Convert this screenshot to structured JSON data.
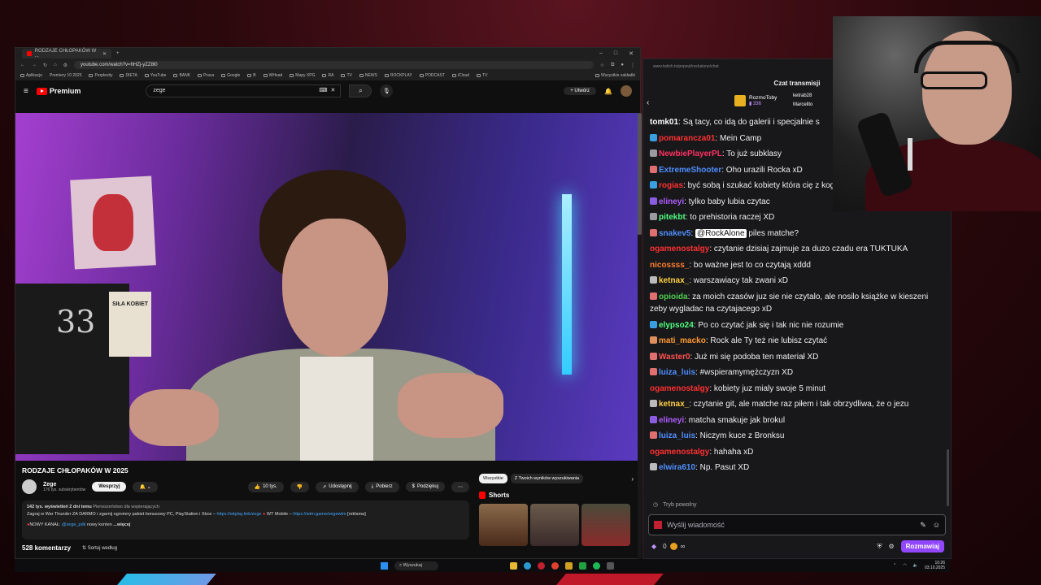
{
  "browser": {
    "tab_title": "RODZAJE CHŁOPAKÓW W ...",
    "url": "youtube.com/watch?v=hHZj-yZZ8l0",
    "bookmarks": [
      "Aplikacje",
      "Premiery 10 2025",
      "Perplexity",
      "DIETA",
      "YouTube",
      "BANK",
      "Praca",
      "Google",
      "B",
      "WHead",
      "Mapy XPG",
      "RA",
      "TV",
      "NEWS",
      "ROCKPLAY",
      "PODCAST",
      "iCloud",
      "TV",
      "Wszystkie zakładki"
    ]
  },
  "youtube": {
    "logo": "Premium",
    "search_value": "zege",
    "create_label": "Utwórz",
    "video_book_text": "SIŁA KOBIET",
    "video_board_text": "33",
    "title": "RODZAJE CHŁOPAKÓW W 2025",
    "channel": "Zege",
    "subs": "176 tys. subskrybentów",
    "support_label": "Wesprzyj",
    "likes": "10 tys.",
    "share_label": "Udostępnij",
    "download_label": "Pobierz",
    "thanks_label": "Podziękuj",
    "desc_stats": "142 tys. wyświetleń  2 dni temu",
    "desc_premiere": "Pierwszeństwo dla wspierających",
    "desc_line2_a": "Zagraj w War Thunder ZA DARMO i zgarnij ogromny pakiet bonusowy PC, PlayStation i Xbox –",
    "desc_link1": "https://wtplay.link/zege",
    "desc_line2_b": "WT Mobile –",
    "desc_link2": "https://wtm.game/zegewtm",
    "desc_line2_c": "[reklama]",
    "desc_line3_a": "NOWY KANAŁ:",
    "desc_link3": "@zege_pdk",
    "desc_line3_b": "nowy konten",
    "desc_more": "...więcej",
    "comments_count": "528 komentarzy",
    "sort_label": "Sortuj według",
    "chip_all": "Wszystkie",
    "chip_search": "Z Twoich wyników wyszukiwania",
    "shorts_label": "Shorts"
  },
  "chat": {
    "url": "www.twitch.tv/popout/rockalone/chat",
    "title": "Czat transmisji",
    "gift_user": "RozmoToby",
    "gift_count": "336",
    "gift_user2": "ketrab28",
    "gift_user3": "Marcelito",
    "messages": [
      {
        "user": "tomk01",
        "color": "#ffffff",
        "text": ": Są tacy, co idą do galerii i specjalnie s",
        "badge": ""
      },
      {
        "user": "pomarancza01",
        "color": "#ff3030",
        "text": ": Mein Camp",
        "badge": "#3a9fe0"
      },
      {
        "user": "NewbiePlayerPL",
        "color": "#ff3060",
        "text": ": To już subklasy",
        "badge": "#9a9aa0"
      },
      {
        "user": "ExtremeShooter",
        "color": "#4f8fff",
        "text": ": Oho urazili Rocka xD",
        "badge": "#e07070"
      },
      {
        "user": "rogias",
        "color": "#ff3030",
        "text": ": być sobą i szukać kobiety która cię z kogoś kim się nie jest",
        "badge": "#3a9fe0",
        "wrap": true
      },
      {
        "user": "elineyi",
        "color": "#b05cff",
        "text": ": tylko baby lubia czytac",
        "badge": "#8a5ce0"
      },
      {
        "user": "pitekbt",
        "color": "#4fff7f",
        "text": ": to prehistoria raczej XD",
        "badge": "#9a9aa0"
      },
      {
        "user": "snakev5",
        "color": "#4f8fff",
        "text": ": ",
        "mention": "@RockAlone",
        "after": " piles matche?",
        "badge": "#e07070"
      },
      {
        "user": "ogamenostalgy",
        "color": "#ff3030",
        "text": ": czytanie dzisiaj zajmuje za duzo czadu era TUKTUKA",
        "badge": ""
      },
      {
        "user": "nicossss_",
        "color": "#ff7f2a",
        "text": ": bo ważne jest to co czytają xddd",
        "badge": ""
      },
      {
        "user": "ketnax_",
        "color": "#ffd040",
        "text": ": warszawiacy tak zwani xD",
        "badge": "#bbb"
      },
      {
        "user": "opioida",
        "color": "#4fcf4f",
        "text": ": za moich czasów juz sie nie czytalo, ale nosilo książke w kieszeni zeby wygladac na czytajacego xD",
        "badge": "#e07070",
        "wrap": true
      },
      {
        "user": "elypso24",
        "color": "#4fff7f",
        "text": ": Po co czytać jak się i tak nic nie rozumie",
        "badge": "#3a9fe0"
      },
      {
        "user": "mati_macko",
        "color": "#ff9a30",
        "text": ": Rock ale Ty też nie lubisz czytać",
        "badge": "#e09060"
      },
      {
        "user": "Waster0",
        "color": "#ff5050",
        "text": ": Już mi się podoba ten materiał XD",
        "badge": "#e07070"
      },
      {
        "user": "luiza_luis",
        "color": "#4f8fff",
        "text": ": #wspieramymężczyzn XD",
        "badge": "#e07070"
      },
      {
        "user": "ogamenostalgy",
        "color": "#ff3030",
        "text": ": kobiety juz mialy swoje 5 minut",
        "badge": ""
      },
      {
        "user": "ketnax_",
        "color": "#ffd040",
        "text": ": czytanie git, ale matche raz piłem i tak obrzydliwa, że o jezu",
        "badge": "#bbb"
      },
      {
        "user": "elineyi",
        "color": "#b05cff",
        "text": ": matcha smakuje jak brokul",
        "badge": "#8a5ce0"
      },
      {
        "user": "luiza_luis",
        "color": "#4f8fff",
        "text": ": Niczym kuce z Bronksu",
        "badge": "#e07070"
      },
      {
        "user": "ogamenostalgy",
        "color": "#ff3030",
        "text": ": hahaha xD",
        "badge": ""
      },
      {
        "user": "elwira610",
        "color": "#4f8fff",
        "text": ": Np. Pasut XD",
        "badge": "#bbb"
      }
    ],
    "mode": "Tryb powolny",
    "placeholder": "Wyślij wiadomość",
    "points": "0",
    "chat_button": "Rozmawiaj"
  },
  "taskbar": {
    "search": "Wyszukaj",
    "time": "10:26",
    "date": "03.10.2025"
  }
}
